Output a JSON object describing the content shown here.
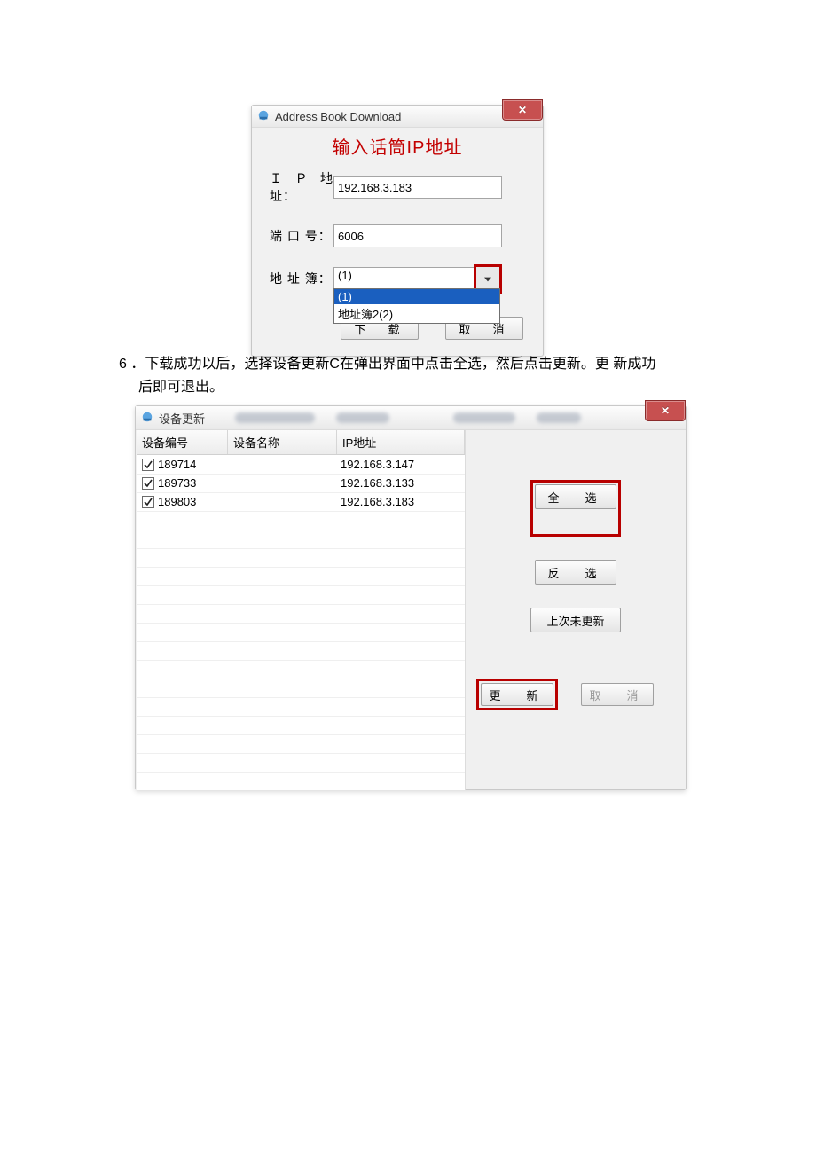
{
  "dialog1": {
    "title": "Address Book Download",
    "header": "输入话筒IP地址",
    "labels": {
      "ip": "ＩＰ地址：",
      "port": "端 口 号：",
      "book": "地 址 簿："
    },
    "ip_value": "192.168.3.183",
    "port_value": "6006",
    "book_value": "(1)",
    "dropdown_items": [
      "(1)",
      "地址簿2(2)"
    ],
    "buttons": {
      "download": "下　载",
      "cancel": "取　消"
    }
  },
  "step": {
    "num": "6",
    "text_line1": "．下载成功以后，选择设备更新C在弹出界面中点击全选，然后点击更新。更 新成功",
    "text_line2": "后即可退出。"
  },
  "dialog2": {
    "title": "设备更新",
    "columns": {
      "id": "设备编号",
      "name": "设备名称",
      "ip": "IP地址"
    },
    "rows": [
      {
        "checked": true,
        "id": "189714",
        "name": "",
        "ip": "192.168.3.147"
      },
      {
        "checked": true,
        "id": "189733",
        "name": "",
        "ip": "192.168.3.133"
      },
      {
        "checked": true,
        "id": "189803",
        "name": "",
        "ip": "192.168.3.183"
      }
    ],
    "buttons": {
      "select_all": "全　选",
      "invert": "反　选",
      "not_updated": "上次未更新",
      "update": "更　新",
      "cancel": "取　消"
    }
  }
}
